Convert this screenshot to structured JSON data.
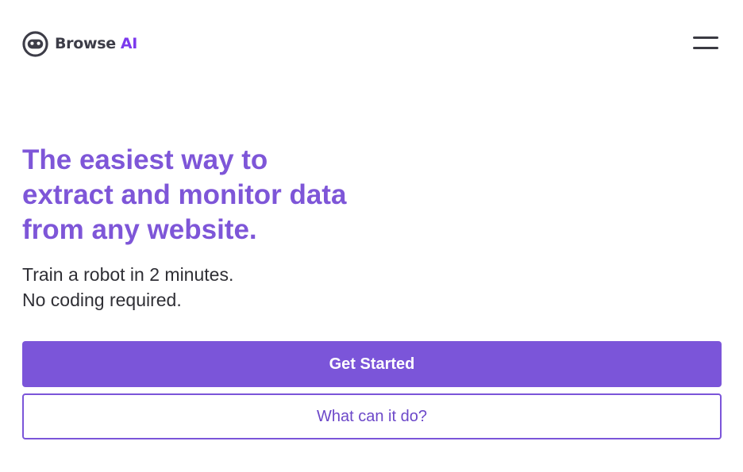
{
  "header": {
    "logo": {
      "icon": "robot-face-icon",
      "brand_part1": "Browse",
      "brand_part2": "AI"
    },
    "menu_icon": "hamburger-menu-icon"
  },
  "hero": {
    "headline_lines": [
      "The easiest way to",
      "extract and monitor data",
      "from any website."
    ],
    "subtitle_lines": [
      "Train a robot in 2 minutes.",
      "No coding required."
    ],
    "primary_button_label": "Get Started",
    "secondary_button_label": "What can it do?"
  },
  "colors": {
    "accent": "#7b55d9",
    "headline": "#7e56d8",
    "brand_ai": "#7c3aed",
    "body_text": "#2f2f35",
    "dark": "#3d3d48",
    "background": "#ffffff"
  }
}
